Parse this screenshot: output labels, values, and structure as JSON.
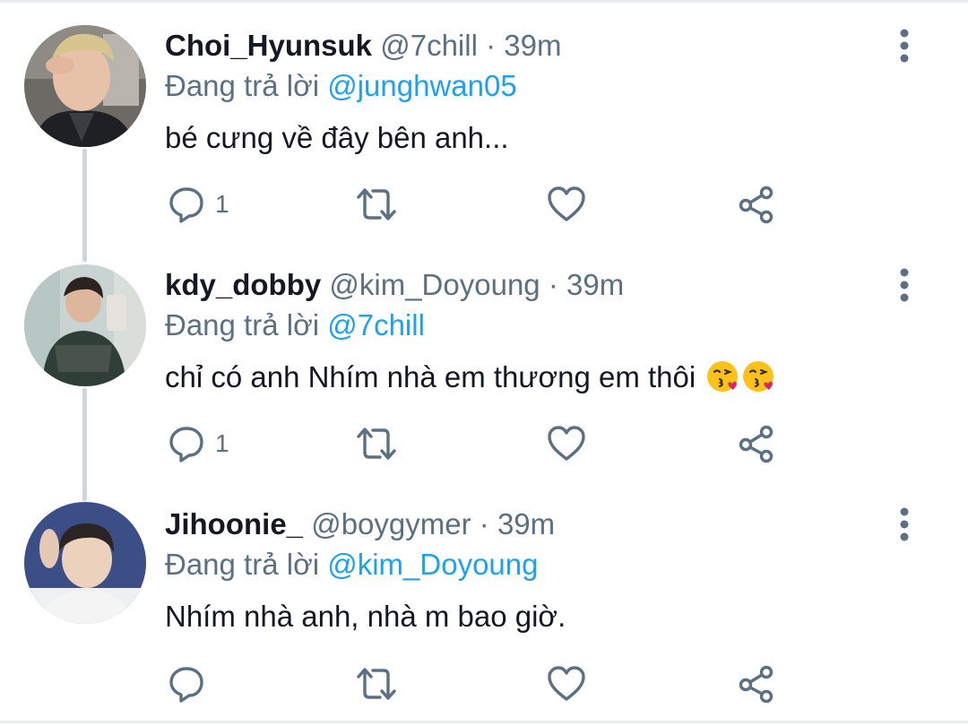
{
  "colors": {
    "name": "#141823",
    "meta": "#5b7083",
    "mention": "#1da1f2",
    "icon": "#5b7083",
    "thread_line": "#cfd6dc"
  },
  "replying_prefix": "Đang trả lời",
  "tweets": [
    {
      "display_name": "Choi_Hyunsuk",
      "handle": "@7chill",
      "separator": "·",
      "time": "39m",
      "replying_to": "@junghwan05",
      "text": "bé cưng về đây bên anh...",
      "reply_count": "1",
      "avatar_icon": "avatar-photo"
    },
    {
      "display_name": "kdy_dobby",
      "handle": "@kim_Doyoung",
      "separator": "·",
      "time": "39m",
      "replying_to": "@7chill",
      "text": "chỉ có anh Nhím nhà em thương em thôi",
      "emoji": [
        "face-blowing-a-kiss",
        "face-blowing-a-kiss"
      ],
      "reply_count": "1",
      "avatar_icon": "avatar-photo"
    },
    {
      "display_name": "Jihoonie_",
      "handle": "@boygymer",
      "separator": "·",
      "time": "39m",
      "replying_to": "@kim_Doyoung",
      "text": "Nhím nhà anh, nhà m bao giờ.",
      "reply_count": "",
      "avatar_icon": "avatar-photo"
    }
  ],
  "icons": {
    "reply": "reply-icon",
    "retweet": "retweet-icon",
    "like": "like-icon",
    "share": "share-icon",
    "more": "more-options-icon"
  }
}
